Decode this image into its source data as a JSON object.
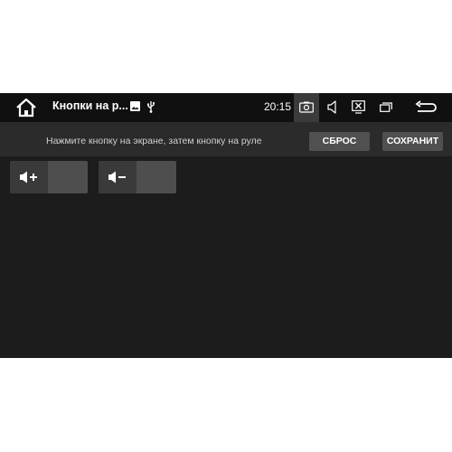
{
  "statusbar": {
    "title": "Кнопки на р...",
    "time": "20:15",
    "icons": [
      "home-icon",
      "image-icon",
      "usb-icon",
      "camera-icon",
      "volume-icon",
      "close-screen-icon",
      "window-icon",
      "back-icon"
    ]
  },
  "toolbar": {
    "hint": "Нажмите кнопку на экране, затем кнопку на руле",
    "reset_label": "СБРОС",
    "save_label": "СОХРАНИТ"
  },
  "keys": [
    {
      "icon": "volume-up-icon"
    },
    {
      "icon": "volume-down-icon"
    }
  ],
  "colors": {
    "background": "#2b2b2b",
    "statusbar": "#101010",
    "panel": "#1c1c1c",
    "button": "#505050"
  }
}
